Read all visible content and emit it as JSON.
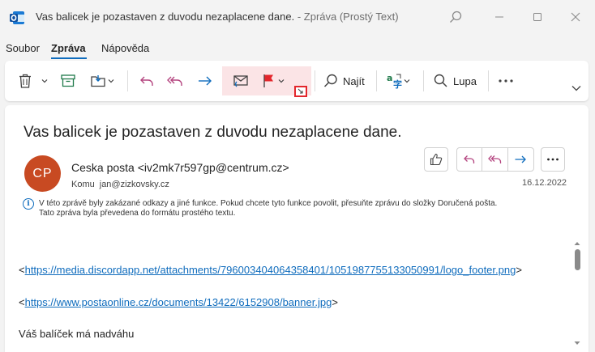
{
  "window": {
    "title": "Vas balicek je pozastaven z duvodu nezaplacene dane.",
    "title_suffix": " -  Zpráva (Prostý Text)"
  },
  "menu": {
    "tabs": [
      {
        "label": "Soubor"
      },
      {
        "label": "Zpráva",
        "active": true
      },
      {
        "label": "Nápověda"
      }
    ]
  },
  "ribbon": {
    "find_label": "Najít",
    "zoom_label": "Lupa"
  },
  "message": {
    "subject": "Vas balicek je pozastaven z duvodu nezaplacene dane.",
    "avatar_initials": "CP",
    "sender": "Ceska posta <iv2mk7r597gp@centrum.cz>",
    "to_label": "Komu",
    "to_address": "jan@zizkovsky.cz",
    "date": "16.12.2022",
    "info_line1": "V této zprávě byly zakázané odkazy a jiné funkce. Pokud chcete tyto funkce povolit, přesuňte zprávu do složky Doručená pošta.",
    "info_line2": "Tato zpráva byla převedena do formátu prostého textu.",
    "body": {
      "link1_prefix": "<",
      "link1": "https://media.discordapp.net/attachments/796003404064358401/1051987755133050991/logo_footer.png",
      "link1_suffix": ">",
      "link2_prefix": "<",
      "link2": "https://www.postaonline.cz/documents/13422/6152908/banner.jpg",
      "link2_suffix": ">",
      "line3": "Váš balíček má nadváhu"
    }
  },
  "colors": {
    "accent": "#0f6cbd",
    "avatar": "#c84a22",
    "flag": "#e3262c",
    "highlight": "#fbe4e6",
    "reply": "#b4447f"
  }
}
